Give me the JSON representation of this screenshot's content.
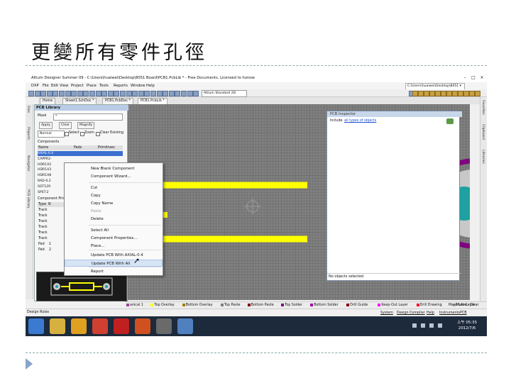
{
  "slide": {
    "title": "更變所有零件孔徑"
  },
  "window": {
    "title": "Altium Designer Summer 09 - C:\\Users\\huaiwei\\Desktop\\8051 Board\\PCB1.PcbLib * - Free Documents. Licensed to horose",
    "path_box": "C:\\Users\\huaiwei\\Desktop\\8051 ▾",
    "menu": [
      "DXP",
      "File",
      "Edit",
      "View",
      "Project",
      "Place",
      "Tools",
      "Reports",
      "Window",
      "Help"
    ],
    "toolbar_dropdown": "Altium Standard 2D",
    "doc_tabs": [
      "Home",
      "Sheet1.SchDoc *",
      "PCB1.PcbDoc *",
      "PCB1.PcbLib *"
    ]
  },
  "left_strip_tabs": [
    "Files",
    "Projects",
    "Navigator",
    "PCB Library"
  ],
  "right_strip_tabs": [
    "Favorites",
    "Clipboard",
    "Libraries"
  ],
  "pcb_library": {
    "title": "PCB Library",
    "mask_label": "Mask",
    "mask_value": "*",
    "buttons": {
      "apply": "Apply",
      "clear": "Clear",
      "magnify": "Magnify"
    },
    "mode_value": "Normal",
    "options": [
      "Select",
      "Zoom",
      "Clear Existing"
    ],
    "components_label": "Components",
    "columns": [
      "Name",
      "Pads",
      "Primitives"
    ],
    "components": [
      "AXIAL-0.4",
      "CAPPR2-",
      "HDR1X2",
      "HDR1X3",
      "HDR1X8",
      "RAD-0.2",
      "SOT129",
      "SPST-2"
    ],
    "primitives_label": "Component Primitives",
    "prim_columns": [
      "Type",
      "N"
    ],
    "primitives": [
      {
        "type": "Track",
        "n": ""
      },
      {
        "type": "Track",
        "n": ""
      },
      {
        "type": "Track",
        "n": ""
      },
      {
        "type": "Track",
        "n": ""
      },
      {
        "type": "Track",
        "n": ""
      },
      {
        "type": "Track",
        "n": ""
      },
      {
        "type": "Pad",
        "n": "1"
      },
      {
        "type": "Pad",
        "n": "2"
      }
    ]
  },
  "context_menu": {
    "items": [
      {
        "label": "New Blank Component",
        "state": "normal"
      },
      {
        "label": "Component Wizard...",
        "state": "normal"
      },
      {
        "label": "Cut",
        "state": "normal"
      },
      {
        "label": "Copy",
        "state": "normal"
      },
      {
        "label": "Copy Name",
        "state": "normal"
      },
      {
        "label": "Paste",
        "state": "disabled"
      },
      {
        "label": "Delete",
        "state": "normal"
      },
      {
        "label": "Select All",
        "state": "normal"
      },
      {
        "label": "Component Properties...",
        "state": "normal"
      },
      {
        "label": "Place...",
        "state": "normal"
      },
      {
        "label": "Update PCB With AXIAL-0.4",
        "state": "normal"
      },
      {
        "label": "Update PCB With All",
        "state": "highlighted"
      },
      {
        "label": "Report",
        "state": "normal"
      }
    ]
  },
  "inspector": {
    "title": "PCB Inspector",
    "include_label": "Include",
    "include_link": "all types of objects",
    "status": "No objects selected"
  },
  "layers": [
    {
      "name": "anical 1",
      "color": "#a040a0"
    },
    {
      "name": "Top Overlay",
      "color": "#ffff00"
    },
    {
      "name": "Bottom Overlay",
      "color": "#a08000"
    },
    {
      "name": "Top Paste",
      "color": "#808080"
    },
    {
      "name": "Bottom Paste",
      "color": "#800000"
    },
    {
      "name": "Top Solder",
      "color": "#800080"
    },
    {
      "name": "Bottom Solder",
      "color": "#a000a0"
    },
    {
      "name": "Drill Guide",
      "color": "#800000"
    },
    {
      "name": "Keep-Out Layer",
      "color": "#ff00ff"
    },
    {
      "name": "Drill Drawing",
      "color": "#ff0030"
    },
    {
      "name": "Multi-Layer",
      "color": "#c0c0c0"
    }
  ],
  "layerbar_right": [
    "Mask Level",
    "Clear"
  ],
  "status": {
    "left": "Design Rules",
    "right": [
      "System",
      "Design Compiler",
      "Help",
      "Instruments",
      "PCB"
    ]
  },
  "taskbar": {
    "apps": [
      {
        "name": "windows-start-icon",
        "color": "#3a7ad0"
      },
      {
        "name": "explorer-icon",
        "color": "#d8b040"
      },
      {
        "name": "media-player-icon",
        "color": "#e0a020"
      },
      {
        "name": "chrome-icon",
        "color": "#d04030"
      },
      {
        "name": "acrobat-icon",
        "color": "#c02020"
      },
      {
        "name": "powerpoint-icon",
        "color": "#d05020"
      },
      {
        "name": "altium-icon",
        "color": "#6a6a6a"
      },
      {
        "name": "paint-icon",
        "color": "#5080c0"
      }
    ],
    "time": "上午 05:35",
    "date": "2012/7/6"
  },
  "colors": {
    "track": "#ffff00",
    "keepout_ring": "#800080",
    "pad_outer": "#c8c8c8",
    "pad_hole": "#20a0a0",
    "selection": "#3a6fcf"
  }
}
